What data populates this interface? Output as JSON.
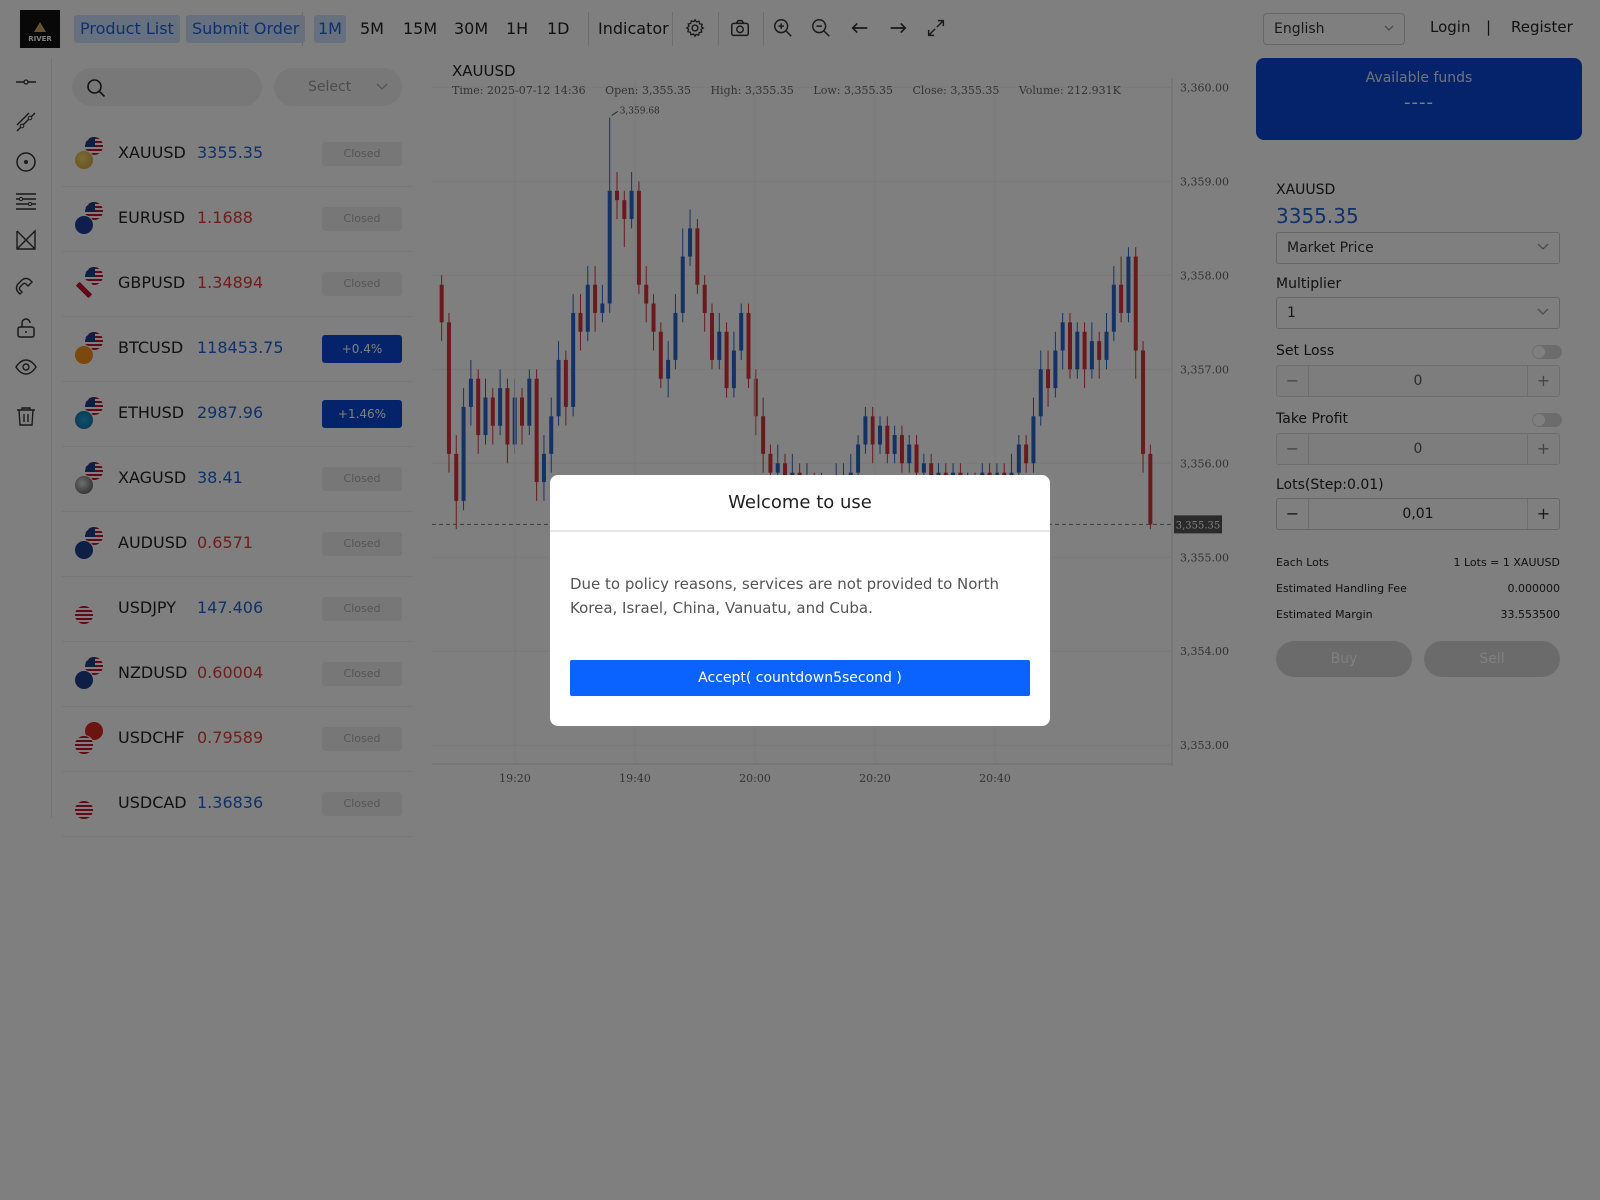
{
  "header": {
    "logo_text": "RIVER",
    "nav": [
      "Product List",
      "Submit Order"
    ],
    "timeframes": [
      "1M",
      "5M",
      "15M",
      "30M",
      "1H",
      "1D"
    ],
    "active_timeframe": "1M",
    "indicator": "Indicator",
    "language": "English",
    "login": "Login",
    "separator": "|",
    "register": "Register",
    "icons": [
      "gear-icon",
      "camera-icon",
      "zoom-in-icon",
      "zoom-out-icon",
      "arrow-left-icon",
      "arrow-right-icon",
      "fullscreen-icon"
    ]
  },
  "drawing_tools": [
    "horizontal-line-icon",
    "trend-line-icon",
    "circle-icon",
    "fib-lines-icon",
    "pattern-icon",
    "magnet-icon",
    "unlock-icon",
    "eye-icon",
    "trash-icon"
  ],
  "product_list": {
    "select_placeholder": "Select",
    "items": [
      {
        "symbol": "XAUUSD",
        "price": "3355.35",
        "price_color": "blue",
        "status": "Closed",
        "flag": "gold"
      },
      {
        "symbol": "EURUSD",
        "price": "1.1688",
        "price_color": "red",
        "status": "Closed",
        "flag": "eu"
      },
      {
        "symbol": "GBPUSD",
        "price": "1.34894",
        "price_color": "red",
        "status": "Closed",
        "flag": "gb"
      },
      {
        "symbol": "BTCUSD",
        "price": "118453.75",
        "price_color": "blue",
        "status": "+0.4%",
        "flag": "btc"
      },
      {
        "symbol": "ETHUSD",
        "price": "2987.96",
        "price_color": "blue",
        "status": "+1.46%",
        "flag": "eth"
      },
      {
        "symbol": "XAGUSD",
        "price": "38.41",
        "price_color": "blue",
        "status": "Closed",
        "flag": "silver"
      },
      {
        "symbol": "AUDUSD",
        "price": "0.6571",
        "price_color": "red",
        "status": "Closed",
        "flag": "au"
      },
      {
        "symbol": "USDJPY",
        "price": "147.406",
        "price_color": "blue",
        "status": "Closed",
        "flag": "jp"
      },
      {
        "symbol": "NZDUSD",
        "price": "0.60004",
        "price_color": "red",
        "status": "Closed",
        "flag": "nz"
      },
      {
        "symbol": "USDCHF",
        "price": "0.79589",
        "price_color": "red",
        "status": "Closed",
        "flag": "ch"
      },
      {
        "symbol": "USDCAD",
        "price": "1.36836",
        "price_color": "blue",
        "status": "Closed",
        "flag": "ca"
      }
    ]
  },
  "chart": {
    "symbol": "XAUUSD",
    "time": "Time: 2025-07-12 14:36",
    "open": "Open: 3,355.35",
    "high": "High: 3,355.35",
    "low": "Low: 3,355.35",
    "close": "Close: 3,355.35",
    "volume": "Volume: 212.931K",
    "max_label": "3,359.68",
    "last_label": "3,355.35"
  },
  "chart_data": {
    "type": "candlestick",
    "x_ticks": [
      "19:20",
      "19:40",
      "20:00",
      "20:20",
      "20:40"
    ],
    "y_ticks": [
      "3,360.00",
      "3,359.00",
      "3,358.00",
      "3,357.00",
      "3,356.00",
      "3,355.00",
      "3,354.00",
      "3,353.00"
    ],
    "ylim": [
      3352.8,
      3360.1
    ],
    "last_price": 3355.35,
    "max_price": 3359.68,
    "up_color": "#2a64c9",
    "down_color": "#d4333a",
    "candles": [
      [
        3357.9,
        3357.5,
        3358.0,
        3357.3
      ],
      [
        3357.5,
        3356.1,
        3357.6,
        3355.9
      ],
      [
        3356.1,
        3355.6,
        3356.3,
        3355.3
      ],
      [
        3355.6,
        3356.6,
        3356.8,
        3355.5
      ],
      [
        3356.6,
        3356.9,
        3357.1,
        3356.4
      ],
      [
        3356.9,
        3356.3,
        3357.0,
        3356.1
      ],
      [
        3356.3,
        3356.7,
        3356.9,
        3356.2
      ],
      [
        3356.7,
        3356.4,
        3356.8,
        3356.2
      ],
      [
        3356.4,
        3356.8,
        3357.0,
        3356.3
      ],
      [
        3356.8,
        3356.2,
        3356.9,
        3356.0
      ],
      [
        3356.2,
        3356.7,
        3356.9,
        3356.1
      ],
      [
        3356.7,
        3356.4,
        3356.8,
        3356.2
      ],
      [
        3356.4,
        3356.9,
        3357.0,
        3356.3
      ],
      [
        3356.9,
        3355.8,
        3357.0,
        3355.6
      ],
      [
        3355.8,
        3356.1,
        3356.3,
        3355.6
      ],
      [
        3356.1,
        3356.5,
        3356.7,
        3355.9
      ],
      [
        3356.5,
        3357.1,
        3357.3,
        3356.4
      ],
      [
        3357.1,
        3356.6,
        3357.2,
        3356.4
      ],
      [
        3356.6,
        3357.6,
        3357.8,
        3356.5
      ],
      [
        3357.6,
        3357.4,
        3357.8,
        3357.2
      ],
      [
        3357.4,
        3357.9,
        3358.1,
        3357.3
      ],
      [
        3357.9,
        3357.6,
        3358.1,
        3357.4
      ],
      [
        3357.6,
        3357.7,
        3357.9,
        3357.5
      ],
      [
        3357.7,
        3358.9,
        3359.68,
        3357.6
      ],
      [
        3358.9,
        3358.8,
        3359.1,
        3358.6
      ],
      [
        3358.8,
        3358.6,
        3358.9,
        3358.3
      ],
      [
        3358.6,
        3358.9,
        3359.1,
        3358.5
      ],
      [
        3358.9,
        3357.9,
        3359.0,
        3357.8
      ],
      [
        3357.9,
        3357.7,
        3358.1,
        3357.5
      ],
      [
        3357.7,
        3357.4,
        3357.8,
        3357.2
      ],
      [
        3357.4,
        3356.9,
        3357.5,
        3356.8
      ],
      [
        3356.9,
        3357.1,
        3357.3,
        3356.7
      ],
      [
        3357.1,
        3357.6,
        3357.8,
        3357.0
      ],
      [
        3357.6,
        3358.2,
        3358.5,
        3357.5
      ],
      [
        3358.2,
        3358.5,
        3358.7,
        3358.1
      ],
      [
        3358.5,
        3357.9,
        3358.6,
        3357.8
      ],
      [
        3357.9,
        3357.6,
        3358.0,
        3357.4
      ],
      [
        3357.6,
        3357.1,
        3357.7,
        3357.0
      ],
      [
        3357.1,
        3357.4,
        3357.6,
        3357.0
      ],
      [
        3357.4,
        3356.8,
        3357.5,
        3356.7
      ],
      [
        3356.8,
        3357.2,
        3357.4,
        3356.7
      ],
      [
        3357.2,
        3357.6,
        3357.7,
        3357.1
      ],
      [
        3357.6,
        3356.9,
        3357.7,
        3356.8
      ],
      [
        3356.9,
        3356.5,
        3357.0,
        3356.3
      ],
      [
        3356.5,
        3356.1,
        3356.7,
        3355.9
      ],
      [
        3356.1,
        3355.9,
        3356.2,
        3355.7
      ],
      [
        3355.9,
        3356.0,
        3356.2,
        3355.7
      ],
      [
        3356.0,
        3355.8,
        3356.1,
        3355.6
      ],
      [
        3355.8,
        3355.9,
        3356.1,
        3355.7
      ],
      [
        3355.9,
        3355.7,
        3356.0,
        3355.5
      ],
      [
        3355.7,
        3355.8,
        3356.0,
        3355.6
      ],
      [
        3355.8,
        3355.6,
        3355.9,
        3355.4
      ],
      [
        3355.6,
        3355.7,
        3355.9,
        3355.5
      ],
      [
        3355.7,
        3355.5,
        3355.8,
        3355.3
      ],
      [
        3355.5,
        3355.8,
        3356.0,
        3355.4
      ],
      [
        3355.8,
        3355.7,
        3356.0,
        3355.6
      ],
      [
        3355.7,
        3355.9,
        3356.1,
        3355.6
      ],
      [
        3355.9,
        3356.2,
        3356.3,
        3355.8
      ],
      [
        3356.2,
        3356.5,
        3356.6,
        3356.1
      ],
      [
        3356.5,
        3356.2,
        3356.6,
        3356.0
      ],
      [
        3356.2,
        3356.4,
        3356.5,
        3356.1
      ],
      [
        3356.4,
        3356.1,
        3356.5,
        3356.0
      ],
      [
        3356.1,
        3356.3,
        3356.4,
        3356.0
      ],
      [
        3356.3,
        3356.0,
        3356.4,
        3355.9
      ],
      [
        3356.0,
        3356.2,
        3356.3,
        3355.9
      ],
      [
        3356.2,
        3355.9,
        3356.3,
        3355.8
      ],
      [
        3355.9,
        3356.0,
        3356.1,
        3355.8
      ],
      [
        3356.0,
        3355.8,
        3356.1,
        3355.7
      ],
      [
        3355.8,
        3355.9,
        3356.0,
        3355.7
      ],
      [
        3355.9,
        3355.8,
        3356.0,
        3355.7
      ],
      [
        3355.8,
        3355.9,
        3356.0,
        3355.7
      ],
      [
        3355.9,
        3355.7,
        3356.0,
        3355.6
      ],
      [
        3355.7,
        3355.8,
        3355.9,
        3355.6
      ],
      [
        3355.8,
        3355.7,
        3355.9,
        3355.6
      ],
      [
        3355.7,
        3355.9,
        3356.0,
        3355.6
      ],
      [
        3355.9,
        3355.8,
        3356.0,
        3355.7
      ],
      [
        3355.8,
        3355.9,
        3356.0,
        3355.7
      ],
      [
        3355.9,
        3355.8,
        3356.0,
        3355.6
      ],
      [
        3355.8,
        3355.9,
        3356.1,
        3355.7
      ],
      [
        3355.9,
        3356.2,
        3356.3,
        3355.8
      ],
      [
        3356.2,
        3356.0,
        3356.3,
        3355.9
      ],
      [
        3356.0,
        3356.5,
        3356.7,
        3355.9
      ],
      [
        3356.5,
        3357.0,
        3357.2,
        3356.4
      ],
      [
        3357.0,
        3356.8,
        3357.2,
        3356.6
      ],
      [
        3356.8,
        3357.2,
        3357.4,
        3356.7
      ],
      [
        3357.2,
        3357.5,
        3357.6,
        3357.0
      ],
      [
        3357.5,
        3357.0,
        3357.6,
        3356.9
      ],
      [
        3357.0,
        3357.4,
        3357.5,
        3356.9
      ],
      [
        3357.4,
        3357.0,
        3357.5,
        3356.8
      ],
      [
        3357.0,
        3357.3,
        3357.5,
        3356.9
      ],
      [
        3357.3,
        3357.1,
        3357.4,
        3356.9
      ],
      [
        3357.1,
        3357.4,
        3357.6,
        3357.0
      ],
      [
        3357.4,
        3357.9,
        3358.1,
        3357.3
      ],
      [
        3357.9,
        3357.6,
        3358.2,
        3357.5
      ],
      [
        3357.6,
        3358.2,
        3358.3,
        3357.5
      ],
      [
        3358.2,
        3357.2,
        3358.3,
        3356.9
      ],
      [
        3357.2,
        3356.1,
        3357.3,
        3355.9
      ],
      [
        3356.1,
        3355.35,
        3356.2,
        3355.3
      ]
    ]
  },
  "funds": {
    "label": "Available funds",
    "value": "----"
  },
  "order": {
    "symbol": "XAUUSD",
    "price": "3355.35",
    "price_type": "Market Price",
    "multiplier_label": "Multiplier",
    "multiplier_value": "1",
    "set_loss_label": "Set Loss",
    "set_loss_value": "0",
    "take_profit_label": "Take Profit",
    "take_profit_value": "0",
    "lots_label": "Lots(Step:0.01)",
    "lots_value": "0,01",
    "minus": "−",
    "plus": "+",
    "each_lots_label": "Each Lots",
    "each_lots_value": "1 Lots = 1 XAUUSD",
    "fee_label": "Estimated Handling Fee",
    "fee_value": "0.000000",
    "margin_label": "Estimated Margin",
    "margin_value": "33.553500",
    "buy": "Buy",
    "sell": "Sell"
  },
  "modal": {
    "title": "Welcome to use",
    "message": "Due to policy reasons, services are not provided to North Korea, Israel, China, Vanuatu, and Cuba.",
    "accept": "Accept( countdown5second )"
  }
}
